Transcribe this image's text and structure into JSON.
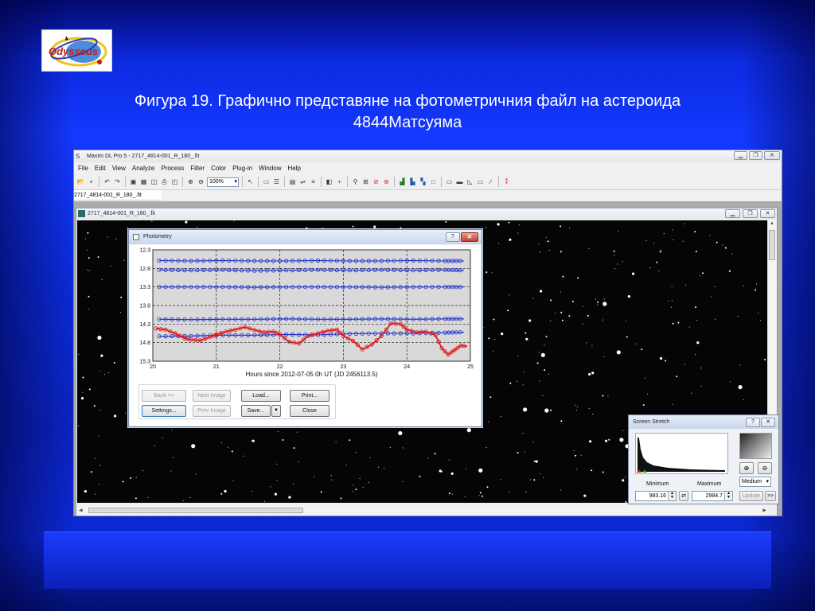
{
  "logo": {
    "text": "Odysseus"
  },
  "slide": {
    "title_line1": "Фигура 19. Графично представяне на фотометричния файл на астероида",
    "title_line2": "4844Матсуяма"
  },
  "app": {
    "title": "MaxIm DL Pro 5 - 2717_4814-001_R_180_.fit",
    "menu": [
      "File",
      "Edit",
      "View",
      "Analyze",
      "Process",
      "Filter",
      "Color",
      "Plug-in",
      "Window",
      "Help"
    ],
    "zoom_value": "100%",
    "document_tab": "2717_4814-001_R_180_.fit",
    "image_window_title": "2717_4814-001_R_180_.fit"
  },
  "photometry": {
    "title": "Photometry",
    "help_glyph": "?",
    "close_glyph": "✕",
    "buttons": {
      "back": "Back <<",
      "next_image": "Next Image",
      "load": "Load...",
      "print": "Print...",
      "settings": "Settings...",
      "prev_image": "Prev Image",
      "save": "Save...",
      "close": "Close"
    }
  },
  "stretch": {
    "title": "Screen Stretch",
    "minimum_label": "Minimum",
    "maximum_label": "Maximum",
    "mode": "Medium",
    "minimum_value": "983.16",
    "maximum_value": "2984.7",
    "update_label": "Update",
    "more_label": ">>"
  },
  "colors": {
    "comparison_star": "#1f2ec8",
    "asteroid": "#e11a1a",
    "plot_bg": "#d9d9d9"
  },
  "chart_data": {
    "type": "scatter",
    "xlabel": "Hours since 2012-07-05 0h UT (JD 2456113.5)",
    "ylabel": "",
    "xlim": [
      20,
      25
    ],
    "ylim": [
      15.3,
      12.3
    ],
    "x_ticks": [
      20,
      21,
      22,
      23,
      24,
      25
    ],
    "y_ticks": [
      12.3,
      12.8,
      13.3,
      13.8,
      14.3,
      14.8,
      15.3
    ],
    "y_inverted": true,
    "grid": true,
    "series": [
      {
        "role": "comparison",
        "color": "#1f2ec8",
        "x": [
          20.1,
          20.6,
          21.1,
          21.6,
          22.1,
          22.6,
          23.1,
          23.6,
          24.1,
          24.6,
          24.9
        ],
        "y": [
          12.59,
          12.6,
          12.59,
          12.6,
          12.6,
          12.59,
          12.6,
          12.6,
          12.59,
          12.6,
          12.6
        ]
      },
      {
        "role": "comparison",
        "color": "#1f2ec8",
        "x": [
          20.1,
          20.6,
          21.1,
          21.6,
          22.1,
          22.6,
          23.1,
          23.6,
          24.1,
          24.6,
          24.9
        ],
        "y": [
          12.84,
          12.85,
          12.84,
          12.86,
          12.85,
          12.84,
          12.85,
          12.84,
          12.85,
          12.84,
          12.85
        ]
      },
      {
        "role": "comparison",
        "color": "#1f2ec8",
        "x": [
          20.1,
          20.6,
          21.1,
          21.6,
          22.1,
          22.6,
          23.1,
          23.6,
          24.1,
          24.6,
          24.9
        ],
        "y": [
          13.3,
          13.3,
          13.3,
          13.31,
          13.3,
          13.3,
          13.3,
          13.31,
          13.3,
          13.3,
          13.3
        ]
      },
      {
        "role": "comparison",
        "color": "#1f2ec8",
        "x": [
          20.1,
          20.6,
          21.1,
          21.6,
          22.1,
          22.6,
          23.1,
          23.6,
          24.1,
          24.6,
          24.9
        ],
        "y": [
          14.17,
          14.18,
          14.17,
          14.17,
          14.16,
          14.17,
          14.17,
          14.16,
          14.17,
          14.16,
          14.16
        ]
      },
      {
        "role": "comparison",
        "color": "#1f2ec8",
        "x": [
          20.1,
          20.6,
          21.1,
          21.6,
          22.1,
          22.6,
          23.1,
          23.6,
          24.1,
          24.6,
          24.9
        ],
        "y": [
          14.63,
          14.62,
          14.6,
          14.6,
          14.58,
          14.59,
          14.56,
          14.55,
          14.55,
          14.53,
          14.52
        ]
      },
      {
        "role": "asteroid",
        "color": "#e11a1a",
        "x": [
          20.05,
          20.2,
          20.35,
          20.5,
          20.6,
          20.75,
          20.9,
          21.0,
          21.15,
          21.3,
          21.45,
          21.6,
          21.75,
          21.9,
          22.0,
          22.15,
          22.3,
          22.45,
          22.6,
          22.75,
          22.9,
          23.0,
          23.15,
          23.3,
          23.45,
          23.6,
          23.75,
          23.9,
          24.0,
          24.15,
          24.3,
          24.45,
          24.55,
          24.65,
          24.75,
          24.85,
          24.95
        ],
        "y": [
          14.42,
          14.45,
          14.55,
          14.68,
          14.72,
          14.74,
          14.65,
          14.58,
          14.5,
          14.45,
          14.38,
          14.46,
          14.52,
          14.5,
          14.58,
          14.78,
          14.82,
          14.62,
          14.55,
          14.48,
          14.45,
          14.62,
          14.75,
          14.98,
          14.85,
          14.62,
          14.28,
          14.3,
          14.45,
          14.52,
          14.5,
          14.6,
          14.95,
          15.12,
          15.0,
          14.88,
          14.9
        ]
      }
    ]
  }
}
